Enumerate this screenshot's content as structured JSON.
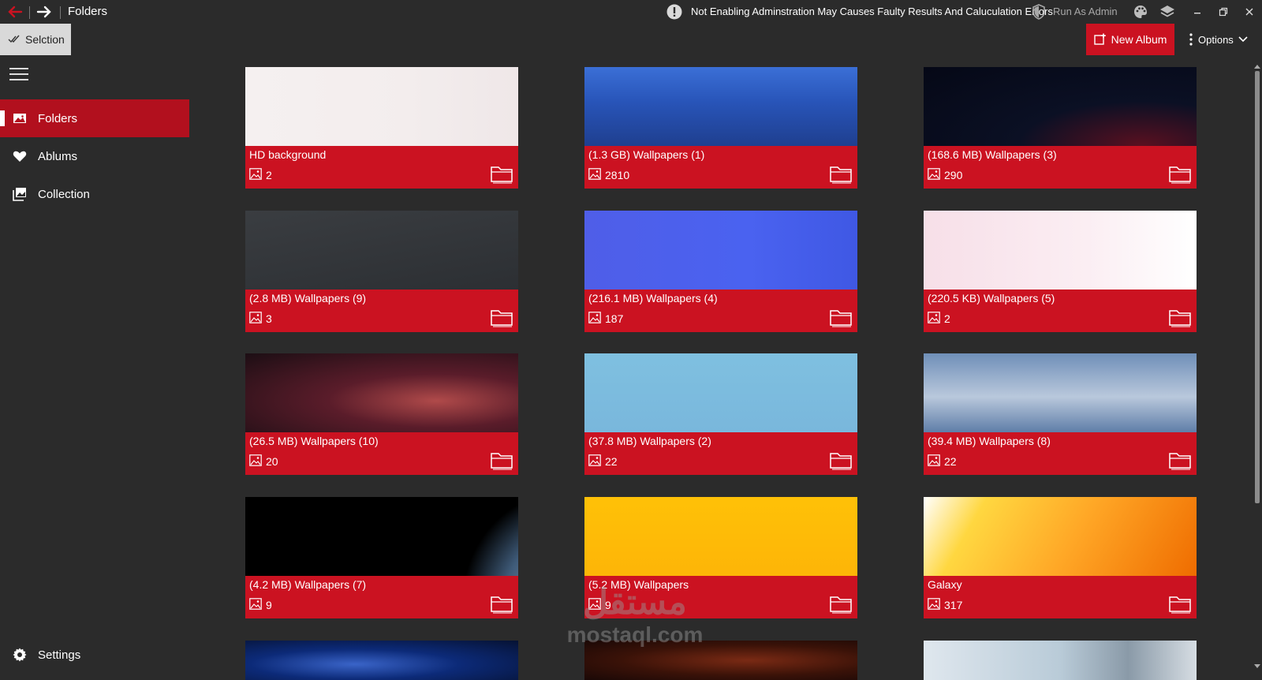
{
  "titlebar": {
    "title": "Folders",
    "warning": "Not Enabling Adminstration May Causes Faulty Results And Caluculation Errors",
    "admin_label": "Run As Admin",
    "back_icon": "arrow-left-icon",
    "forward_icon": "arrow-right-icon"
  },
  "commandbar": {
    "selection_label": "Selction",
    "new_album_label": "New Album",
    "options_label": "Options"
  },
  "sidebar": {
    "items": [
      {
        "label": "Folders",
        "icon": "image-icon",
        "active": true
      },
      {
        "label": "Ablums",
        "icon": "heart-icon",
        "active": false
      },
      {
        "label": "Collection",
        "icon": "photos-collection-icon",
        "active": false
      }
    ],
    "settings_label": "Settings"
  },
  "folders": [
    {
      "name": "HD background",
      "count": "2"
    },
    {
      "name": "(1.3 GB) Wallpapers (1)",
      "count": "2810"
    },
    {
      "name": "(168.6 MB) Wallpapers (3)",
      "count": "290"
    },
    {
      "name": "(2.8 MB) Wallpapers (9)",
      "count": "3"
    },
    {
      "name": "(216.1 MB) Wallpapers (4)",
      "count": "187"
    },
    {
      "name": "(220.5 KB) Wallpapers (5)",
      "count": "2"
    },
    {
      "name": "(26.5 MB) Wallpapers (10)",
      "count": "20"
    },
    {
      "name": "(37.8 MB) Wallpapers (2)",
      "count": "22"
    },
    {
      "name": "(39.4 MB) Wallpapers (8)",
      "count": "22"
    },
    {
      "name": "(4.2 MB) Wallpapers (7)",
      "count": "9"
    },
    {
      "name": "(5.2 MB) Wallpapers",
      "count": "9"
    },
    {
      "name": "Galaxy",
      "count": "317"
    }
  ],
  "watermark": {
    "arabic": "مستقل",
    "latin": "mostaql.com"
  },
  "colors": {
    "accent": "#cb1221",
    "background": "#2b2b2b",
    "active_nav": "#b2101e"
  }
}
